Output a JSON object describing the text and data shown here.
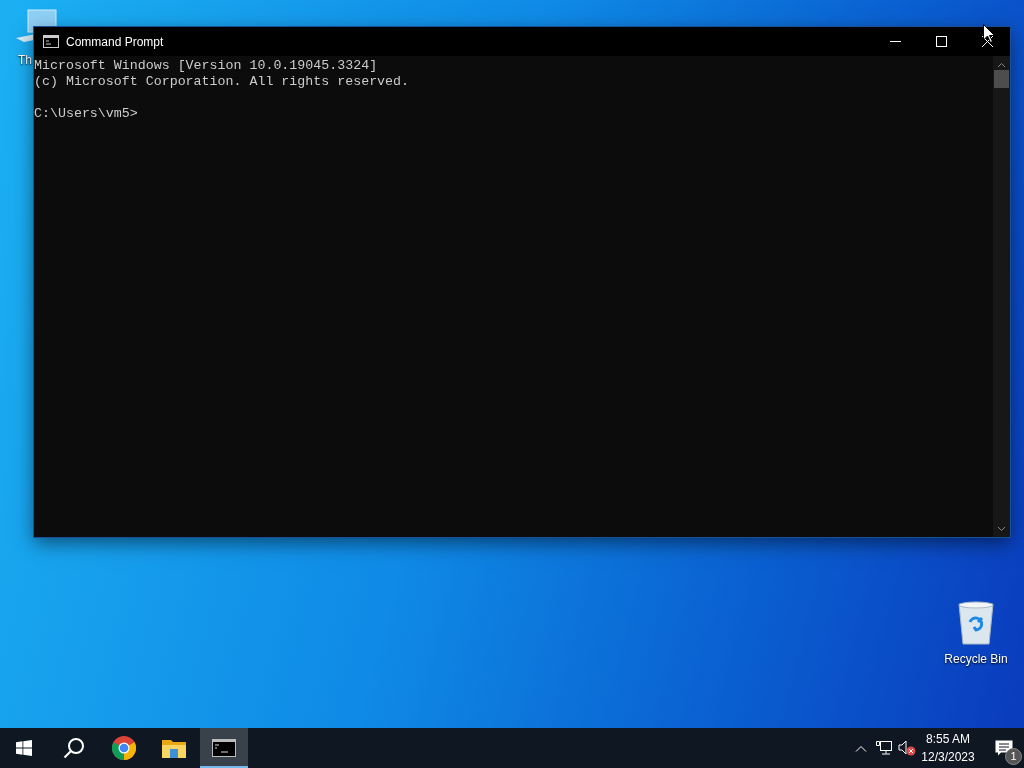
{
  "desktop_icons": [
    {
      "kind": "this-pc",
      "label": "Th"
    },
    {
      "kind": "recycle-bin",
      "label": "Recycle Bin"
    }
  ],
  "window": {
    "title": "Command Prompt",
    "console_lines": [
      "Microsoft Windows [Version 10.0.19045.3324]",
      "(c) Microsoft Corporation. All rights reserved."
    ],
    "prompt": "C:\\Users\\vm5>"
  },
  "taskbar": {
    "apps": [
      {
        "kind": "start",
        "selected": false
      },
      {
        "kind": "search",
        "selected": false
      },
      {
        "kind": "chrome",
        "selected": false
      },
      {
        "kind": "explorer",
        "selected": false
      },
      {
        "kind": "cmd",
        "selected": true
      }
    ],
    "tray": {
      "volume_muted": true,
      "time": "8:55 AM",
      "date": "12/3/2023",
      "notification_count": "1"
    }
  }
}
